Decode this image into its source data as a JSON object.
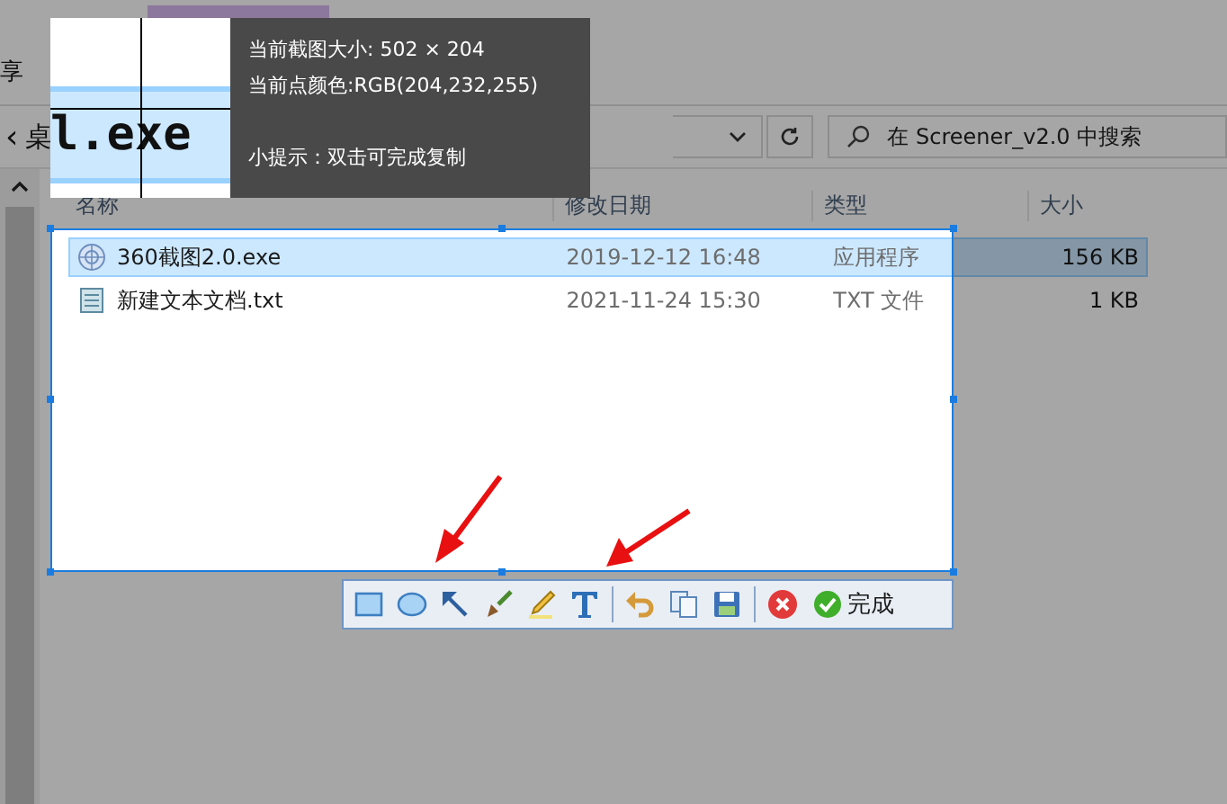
{
  "ribbon": {
    "label": "享"
  },
  "address_bar": {
    "back": "‹",
    "path_fragment": "桌"
  },
  "search": {
    "placeholder": "在 Screener_v2.0 中搜索"
  },
  "columns": [
    "名称",
    "修改日期",
    "类型",
    "大小"
  ],
  "files": [
    {
      "name": "360截图2.0.exe",
      "kind": "app",
      "modified": "2019-12-12 16:48",
      "type": "应用程序",
      "size": "156 KB",
      "selected": true
    },
    {
      "name": "新建文本文档.txt",
      "kind": "text",
      "modified": "2021-11-24 15:30",
      "type": "TXT 文件",
      "size": "1 KB",
      "selected": false
    }
  ],
  "magnifier": {
    "text": "l.exe"
  },
  "capture_info": {
    "size_line": "当前截图大小: 502 × 204",
    "color_line": "当前点颜色:RGB(204,232,255)",
    "hint": "小提示：双击可完成复制"
  },
  "toolbar": {
    "tools": [
      {
        "kind": "rectangle"
      },
      {
        "kind": "ellipse"
      },
      {
        "kind": "arrow"
      },
      {
        "kind": "brush"
      },
      {
        "kind": "pencil"
      },
      {
        "kind": "text"
      },
      {
        "kind": "separator"
      },
      {
        "kind": "undo"
      },
      {
        "kind": "copy"
      },
      {
        "kind": "save"
      },
      {
        "kind": "separator"
      },
      {
        "kind": "cancel"
      }
    ],
    "done_label": "完成"
  }
}
